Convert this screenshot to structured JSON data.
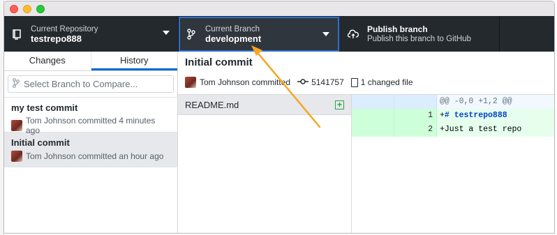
{
  "toolbar": {
    "repo_label": "Current Repository",
    "repo_value": "testrepo888",
    "branch_label": "Current Branch",
    "branch_value": "development",
    "publish_label": "Publish branch",
    "publish_sub": "Publish this branch to GitHub"
  },
  "sidebar": {
    "tabs": [
      {
        "label": "Changes"
      },
      {
        "label": "History"
      }
    ],
    "compare_placeholder": "Select Branch to Compare...",
    "commits": [
      {
        "title": "my test commit",
        "meta": "Tom Johnson committed 4 minutes ago"
      },
      {
        "title": "Initial commit",
        "meta": "Tom Johnson committed an hour ago"
      }
    ]
  },
  "commit_detail": {
    "title": "Initial commit",
    "author": "Tom Johnson committed",
    "sha": "5141757",
    "changed": "1 changed file"
  },
  "files": [
    {
      "name": "README.md"
    }
  ],
  "diff": {
    "hunk": "@@ -0,0 +1,2 @@",
    "lines": [
      {
        "num": "1",
        "prefix": "+",
        "text": "# testrepo888"
      },
      {
        "num": "2",
        "prefix": "+",
        "text": "Just a test repo"
      }
    ]
  },
  "colors": {
    "accent": "#0366d6",
    "toolbar_bg": "#24292e",
    "annotation_arrow": "#f5a623",
    "added_green": "#28a745"
  }
}
